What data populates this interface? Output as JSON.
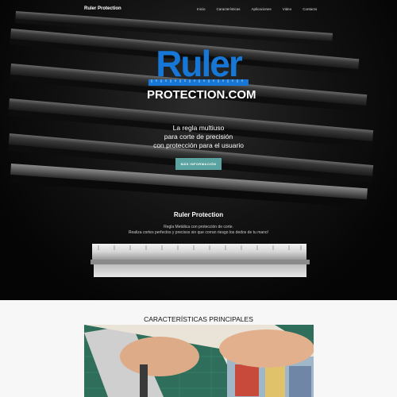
{
  "nav": {
    "brand": "Ruler Protection",
    "links": [
      "Inicio",
      "Características",
      "Aplicaciones",
      "Video",
      "Contacto"
    ]
  },
  "hero": {
    "logo_word": "Ruler",
    "logo_domain": "PROTECTION.COM",
    "tagline": [
      "La regla multiuso",
      "para corte de precisión",
      "con protección para el usuario"
    ],
    "cta_label": "MÁS INFORMACIÓN"
  },
  "product": {
    "title": "Ruler Protection",
    "desc": [
      "Regla Metálica con protección de corte.",
      "Realiza cortes perfectos y precisos sin que corran riesgo los dedos de tu mano!"
    ]
  },
  "features": {
    "title": "CARACTERÍSTICAS PRINCIPALES"
  },
  "colors": {
    "brand_blue": "#1677d6",
    "cta": "#5aa3a0",
    "features_bg": "#f7f7f7"
  }
}
